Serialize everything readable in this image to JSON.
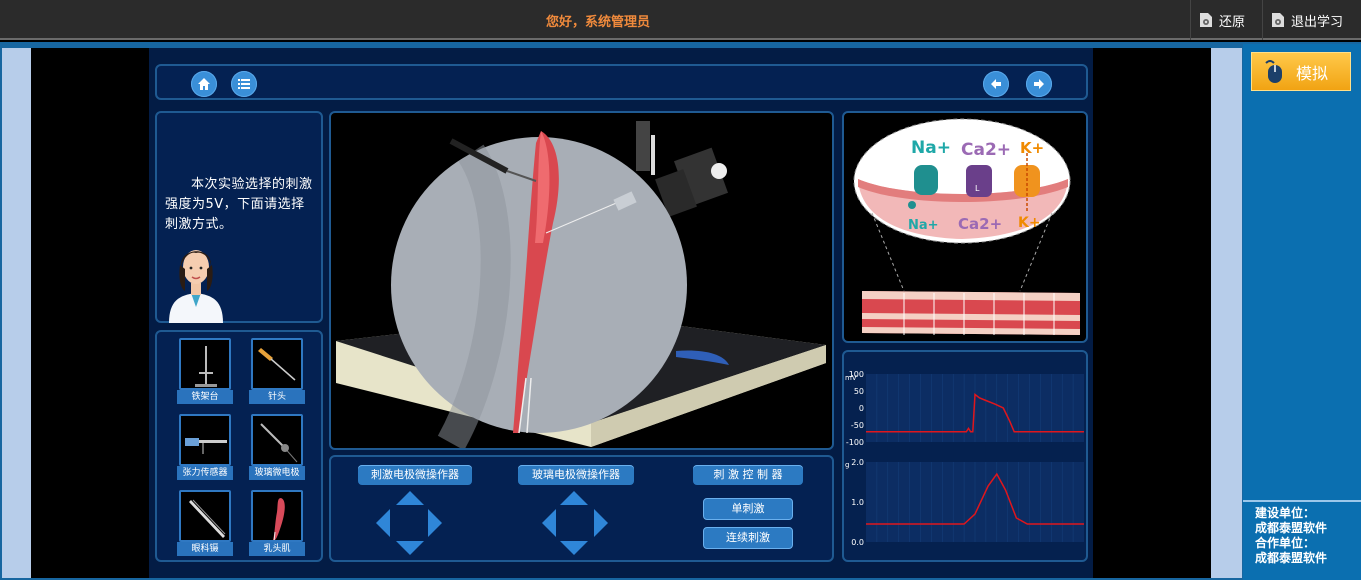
{
  "topbar": {
    "greeting": "您好，系统管理员",
    "restore_label": "还原",
    "exit_label": "退出学习"
  },
  "nav": {
    "home_icon": "home-icon",
    "menu_icon": "list-menu-icon",
    "prev_icon": "arrow-left-icon",
    "next_icon": "arrow-right-icon"
  },
  "instruction": {
    "text": "本次实验选择的刺激强度为5V，下面请选择刺激方式。"
  },
  "tools": [
    {
      "label": "铁架台"
    },
    {
      "label": "针头"
    },
    {
      "label": "张力传感器"
    },
    {
      "label": "玻璃微电极"
    },
    {
      "label": "眼科镊"
    },
    {
      "label": "乳头肌"
    }
  ],
  "channel_diagram": {
    "ion_top": [
      "Na+",
      "Ca2+",
      "K+"
    ],
    "ion_bottom": [
      "Na+",
      "Ca2+",
      "K+"
    ],
    "channel_mark": "L"
  },
  "charts": {
    "top_unit": "mV",
    "bottom_unit": "g"
  },
  "controls": {
    "stim_electrode_manipulator": "刺激电极微操作器",
    "glass_electrode_manipulator": "玻璃电极微操作器",
    "stim_controller": "刺 激 控 制 器",
    "single_stim": "单刺激",
    "continuous_stim": "连续刺激"
  },
  "sidebar": {
    "simulate_label": "模拟",
    "builder_label": "建设单位：",
    "builder_name": "成都泰盟软件",
    "partner_label": "合作单位：",
    "partner_name": "成都泰盟软件"
  },
  "colors": {
    "accent_orange": "#f08a3c",
    "trace_red": "#e0161c",
    "panel_blue": "#042152"
  },
  "chart_data": [
    {
      "type": "line",
      "ylabel": "mV",
      "ylim": [
        -100,
        100
      ],
      "yticks": [
        100,
        50,
        0,
        -50,
        -100
      ],
      "series": [
        {
          "values": [
            [
              0,
              -70
            ],
            [
              92,
              -70
            ],
            [
              94,
              -60
            ],
            [
              96,
              -70
            ],
            [
              98,
              -70
            ],
            [
              100,
              40
            ],
            [
              104,
              30
            ],
            [
              110,
              22
            ],
            [
              118,
              12
            ],
            [
              126,
              0
            ],
            [
              132,
              -40
            ],
            [
              136,
              -70
            ],
            [
              200,
              -70
            ]
          ]
        }
      ]
    },
    {
      "type": "line",
      "ylabel": "g",
      "ylim": [
        0,
        2.0
      ],
      "yticks": [
        2.0,
        1.0,
        0.0
      ],
      "series": [
        {
          "values": [
            [
              0,
              0.45
            ],
            [
              90,
              0.45
            ],
            [
              100,
              0.7
            ],
            [
              112,
              1.4
            ],
            [
              120,
              1.7
            ],
            [
              128,
              1.3
            ],
            [
              138,
              0.6
            ],
            [
              148,
              0.45
            ],
            [
              200,
              0.45
            ]
          ]
        }
      ]
    }
  ]
}
